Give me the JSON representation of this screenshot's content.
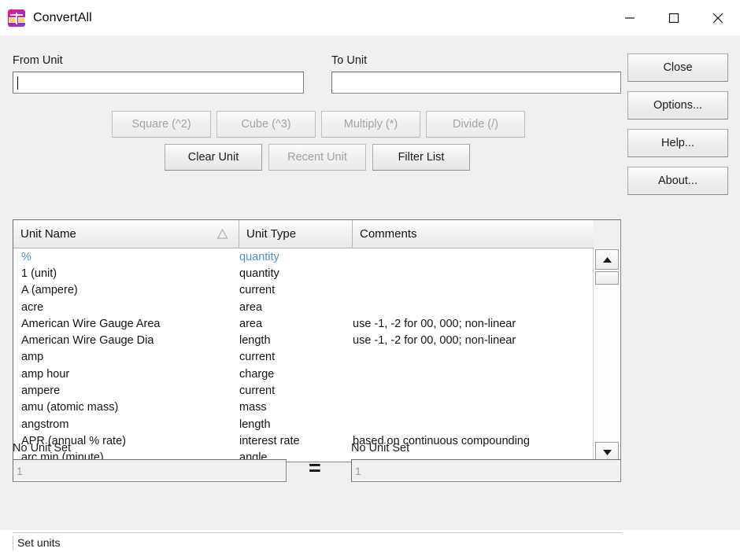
{
  "window": {
    "title": "ConvertAll",
    "icon": "balance-scale-icon",
    "minimize_label": "–",
    "maximize_label": "□",
    "close_label": "✕"
  },
  "from_unit": {
    "label": "From Unit",
    "value": "",
    "placeholder": ""
  },
  "to_unit": {
    "label": "To Unit",
    "value": "",
    "placeholder": ""
  },
  "operator_buttons": [
    {
      "label": "Square (^2)",
      "enabled": false
    },
    {
      "label": "Cube (^3)",
      "enabled": false
    },
    {
      "label": "Multiply (*)",
      "enabled": false
    },
    {
      "label": "Divide (/)",
      "enabled": false
    }
  ],
  "action_buttons": [
    {
      "label": "Clear Unit",
      "enabled": true
    },
    {
      "label": "Recent Unit",
      "enabled": false
    },
    {
      "label": "Filter List",
      "enabled": true
    }
  ],
  "side_buttons": [
    {
      "label": "Close"
    },
    {
      "label": "Options..."
    },
    {
      "label": "Help..."
    },
    {
      "label": "About..."
    }
  ],
  "unit_list": {
    "columns": [
      "Unit Name",
      "Unit Type",
      "Comments"
    ],
    "sort_column": "Unit Name",
    "sort_direction": "ascending",
    "rows": [
      {
        "name": "%",
        "type": "quantity",
        "comment": "",
        "selected": true
      },
      {
        "name": "1  (unit)",
        "type": "quantity",
        "comment": "",
        "selected": false
      },
      {
        "name": "A  (ampere)",
        "type": "current",
        "comment": "",
        "selected": false
      },
      {
        "name": "acre",
        "type": "area",
        "comment": "",
        "selected": false
      },
      {
        "name": "American Wire Gauge Area",
        "type": "area",
        "comment": "use -1, -2 for 00, 000; non-linear",
        "selected": false
      },
      {
        "name": "American Wire Gauge Dia",
        "type": "length",
        "comment": "use -1, -2 for 00, 000; non-linear",
        "selected": false
      },
      {
        "name": "amp",
        "type": "current",
        "comment": "",
        "selected": false
      },
      {
        "name": "amp hour",
        "type": "charge",
        "comment": "",
        "selected": false
      },
      {
        "name": "ampere",
        "type": "current",
        "comment": "",
        "selected": false
      },
      {
        "name": "amu  (atomic mass)",
        "type": "mass",
        "comment": "",
        "selected": false
      },
      {
        "name": "angstrom",
        "type": "length",
        "comment": "",
        "selected": false
      },
      {
        "name": "APR  (annual % rate)",
        "type": "interest rate",
        "comment": "based on continuous compounding",
        "selected": false
      },
      {
        "name": "arc min  (minute)",
        "type": "angle",
        "comment": "",
        "selected": false
      }
    ]
  },
  "result": {
    "from_label": "No Unit Set",
    "to_label": "No Unit Set",
    "from_value": "1",
    "to_value": "1",
    "equals": "="
  },
  "status": {
    "text": "Set units"
  },
  "colors": {
    "selection_text": "#4d8fd6",
    "window_bg": "#f0f0f0",
    "field_bg": "#ffffff",
    "disabled_text": "#a3a3a3"
  }
}
